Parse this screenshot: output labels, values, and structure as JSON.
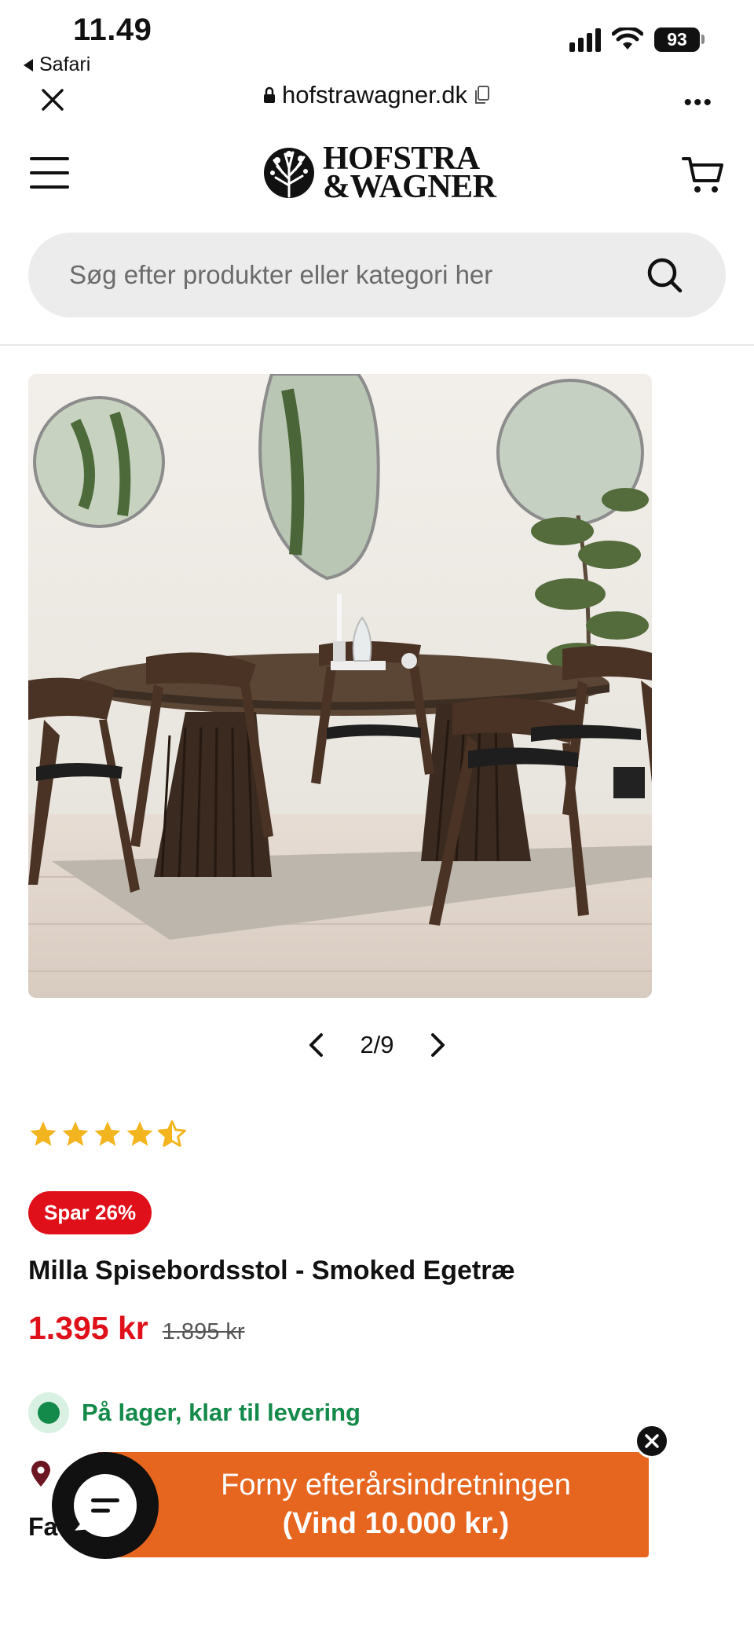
{
  "status_bar": {
    "time": "11.49",
    "back_app": "Safari",
    "battery": "93",
    "icons": [
      "signal-icon",
      "wifi-icon",
      "battery-icon"
    ]
  },
  "browser": {
    "url": "hofstrawagner.dk",
    "icons": [
      "close-icon",
      "lock-icon",
      "copy-icon",
      "more-icon"
    ]
  },
  "header": {
    "logo_line1": "HOFSTRA",
    "logo_line2": "&WAGNER",
    "icons": [
      "menu-icon",
      "tree-logo-icon",
      "cart-icon"
    ]
  },
  "search": {
    "placeholder": "Søg efter produkter eller kategori her",
    "icon": "search-icon"
  },
  "gallery": {
    "counter": "2/9",
    "icons": [
      "chevron-left-icon",
      "chevron-right-icon"
    ]
  },
  "product": {
    "rating": 4.5,
    "rating_max": 5,
    "star_color": "#f2b51f",
    "badge": "Spar 26%",
    "title": "Milla Spisebordsstol - Smoked Egetræ",
    "price": "1.395 kr",
    "old_price": "1.895 kr",
    "stock_text": "På lager, klar til levering",
    "partial_label": "Fa",
    "accent_red": "#e0101a",
    "stock_green": "#148a4a"
  },
  "promo": {
    "line1": "Forny efterårsindretningen",
    "line2": "(Vind 10.000 kr.)",
    "color": "#e6651f"
  },
  "chat": {
    "icon": "chat-icon"
  }
}
